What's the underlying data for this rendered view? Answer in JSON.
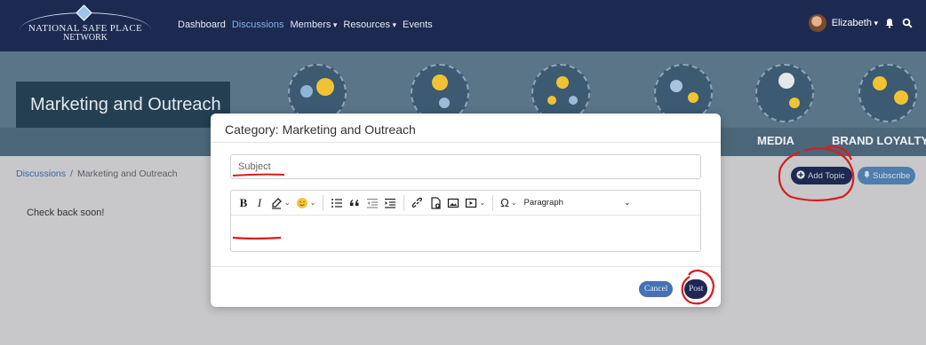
{
  "nav": {
    "logo_line1": "NATIONAL SAFE PLACE",
    "logo_line2": "NETWORK",
    "links": [
      {
        "label": "Dashboard",
        "active": false,
        "dropdown": false
      },
      {
        "label": "Discussions",
        "active": true,
        "dropdown": false
      },
      {
        "label": "Members",
        "active": false,
        "dropdown": true
      },
      {
        "label": "Resources",
        "active": false,
        "dropdown": true
      },
      {
        "label": "Events",
        "active": false,
        "dropdown": false
      }
    ],
    "user_name": "Elizabeth",
    "icons": [
      "bell-icon",
      "search-icon"
    ]
  },
  "banner": {
    "title": "Marketing and Outreach",
    "category_labels": [
      "MEDIA",
      "BRAND LOYALTY"
    ]
  },
  "page": {
    "breadcrumb_root": "Discussions",
    "breadcrumb_separator": "/",
    "breadcrumb_current": "Marketing and Outreach",
    "empty_message": "Check back soon!",
    "add_topic_label": "Add Topic",
    "subscribe_label": "Subscribe"
  },
  "modal": {
    "title": "Category: Marketing and Outreach",
    "subject_placeholder": "Subject",
    "subject_value": "",
    "format_value": "Paragraph",
    "body_value": "",
    "cancel_label": "Cancel",
    "post_label": "Post"
  },
  "colors": {
    "nav_bg": "#1c2a52",
    "active_link": "#7fb2e5",
    "banner_bg": "#5a7488",
    "add_topic_bg": "#1e2952",
    "subscribe_bg": "#4f7dac",
    "cancel_bg": "#4472b3",
    "post_bg": "#1f2653",
    "annotation_red": "#d81e1e"
  }
}
